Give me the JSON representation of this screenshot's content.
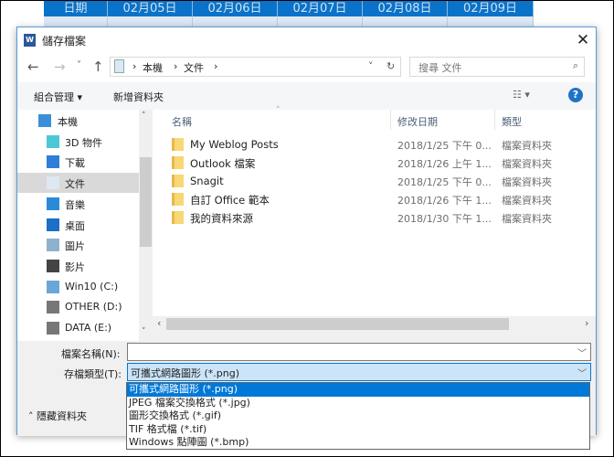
{
  "background_table": {
    "headers": [
      "日期",
      "02月05日",
      "02月06日",
      "02月07日",
      "02月08日",
      "02月09日"
    ]
  },
  "dialog": {
    "title": "儲存檔案",
    "close_label": "✕",
    "nav": {
      "back": "←",
      "forward": "→",
      "recent": "˅",
      "up": "↑",
      "breadcrumb": [
        "本機",
        "文件"
      ],
      "refresh": "↻",
      "search_placeholder": "搜尋 文件"
    },
    "toolbar": {
      "organize": "組合管理 ▾",
      "new_folder": "新增資料夾",
      "view": "▾",
      "help": "?"
    },
    "nav_pane": [
      {
        "label": "本機",
        "icon": "computer-icon"
      },
      {
        "label": "3D 物件",
        "icon": "cube-icon"
      },
      {
        "label": "下載",
        "icon": "download-icon"
      },
      {
        "label": "文件",
        "icon": "document-icon",
        "selected": true
      },
      {
        "label": "音樂",
        "icon": "music-icon"
      },
      {
        "label": "桌面",
        "icon": "desktop-icon"
      },
      {
        "label": "圖片",
        "icon": "pictures-icon"
      },
      {
        "label": "影片",
        "icon": "video-icon"
      },
      {
        "label": "Win10 (C:)",
        "icon": "windows-drive-icon"
      },
      {
        "label": "OTHER (D:)",
        "icon": "drive-icon"
      },
      {
        "label": "DATA (E:)",
        "icon": "drive-icon"
      }
    ],
    "columns": [
      "名稱",
      "修改日期",
      "類型"
    ],
    "files": [
      {
        "name": "My Weblog Posts",
        "date": "2018/1/25 下午 0...",
        "type": "檔案資料夾"
      },
      {
        "name": "Outlook 檔案",
        "date": "2018/1/26 上午 1...",
        "type": "檔案資料夾"
      },
      {
        "name": "Snagit",
        "date": "2018/1/25 下午 0...",
        "type": "檔案資料夾"
      },
      {
        "name": "自訂 Office 範本",
        "date": "2018/1/26 下午 1...",
        "type": "檔案資料夾"
      },
      {
        "name": "我的資料來源",
        "date": "2018/1/30 下午 1...",
        "type": "檔案資料夾"
      }
    ],
    "filename_label": "檔案名稱(N):",
    "filename_value": "",
    "filetype_label": "存檔類型(T):",
    "filetype_value": "可攜式網路圖形 (*.png)",
    "filetype_options": [
      "可攜式網路圖形 (*.png)",
      "JPEG 檔案交換格式 (*.jpg)",
      "圖形交換格式 (*.gif)",
      "TIF 格式檔 (*.tif)",
      "Windows 點陣圖 (*.bmp)"
    ],
    "hide_folders": "隱藏資料夾"
  }
}
